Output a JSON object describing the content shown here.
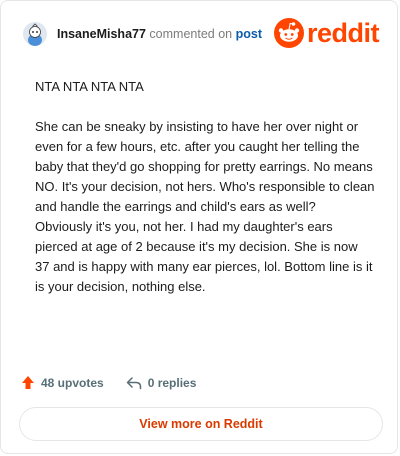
{
  "header": {
    "username": "InsaneMisha77",
    "action_text": "commented on",
    "post_link": "post",
    "avatar_icon": "snoo-avatar-icon"
  },
  "brand": {
    "name": "reddit",
    "color": "#ff4500",
    "icon": "reddit-snoo-icon"
  },
  "comment": {
    "paragraphs": [
      "NTA NTA NTA NTA",
      "She can be sneaky by insisting to have her over night or even for a few hours, etc. after you caught her telling the baby that they'd go shopping for pretty earrings. No means NO. It's your decision, not hers. Who's responsible to clean and handle the earrings and child's ears as well? Obviously it's you, not her. I had my daughter's ears pierced at age of 2 because it's my decision. She is now 37 and is happy with many ear pierces, lol. Bottom line is it is your decision, nothing else."
    ]
  },
  "actions": {
    "upvotes": "48 upvotes",
    "upvote_icon": "upvote-arrow-icon",
    "upvote_color": "#ff4500",
    "replies": "0 replies",
    "reply_icon": "reply-arrow-icon"
  },
  "footer": {
    "view_more": "View more on Reddit",
    "accent_color": "#d93a00"
  }
}
